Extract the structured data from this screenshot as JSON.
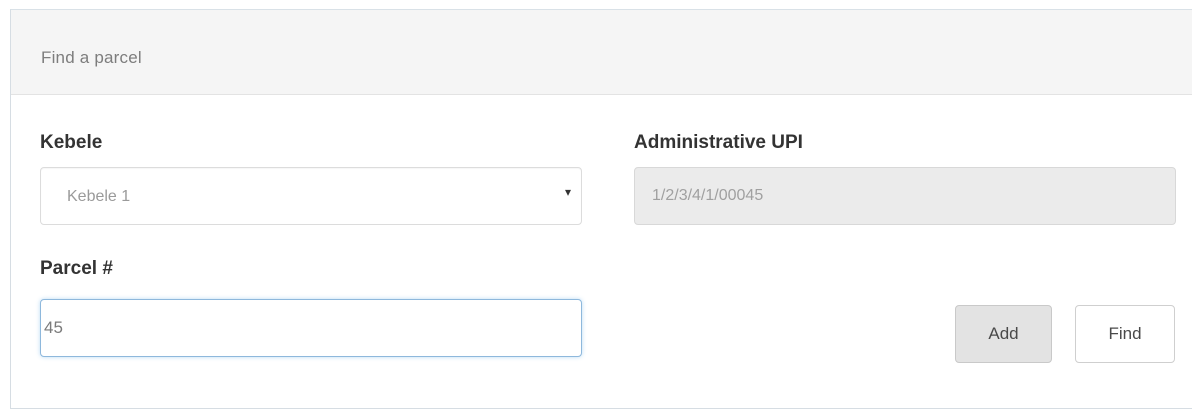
{
  "panel": {
    "title": "Find a parcel"
  },
  "kebele": {
    "label": "Kebele",
    "selected": "Kebele 1",
    "caret": "▾"
  },
  "administrative_upi": {
    "label": "Administrative UPI",
    "value": "1/2/3/4/1/00045"
  },
  "parcel": {
    "label": "Parcel #",
    "value": "45"
  },
  "buttons": {
    "add": "Add",
    "find": "Find"
  }
}
